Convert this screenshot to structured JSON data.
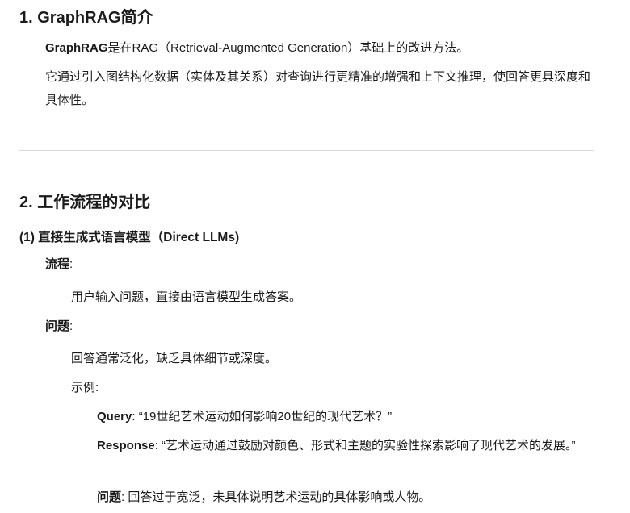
{
  "section1": {
    "title": "1. GraphRAG简介",
    "intro_bold": "GraphRAG",
    "intro_rest": "是在RAG（Retrieval-Augmented Generation）基础上的改进方法。",
    "desc": "它通过引入图结构化数据（实体及其关系）对查询进行更精准的增强和上下文推理，使回答更具深度和具体性。"
  },
  "section2": {
    "title": "2. 工作流程的对比",
    "sub1": {
      "title": "(1) 直接生成式语言模型（Direct LLMs)",
      "process_label": "流程",
      "process_text": "用户输入问题，直接由语言模型生成答案。",
      "problem_label": "问题",
      "problem_text": "回答通常泛化，缺乏具体细节或深度。",
      "example_label": "示例",
      "query_label": "Query",
      "query_text": "“19世纪艺术运动如何影响20世纪的现代艺术？”",
      "response_label": "Response",
      "response_text": "“艺术运动通过鼓励对颜色、形式和主题的实验性探索影响了现代艺术的发展。”",
      "issue_label": "问题",
      "issue_text": "回答过于宽泛，未具体说明艺术运动的具体影响或人物。"
    }
  }
}
